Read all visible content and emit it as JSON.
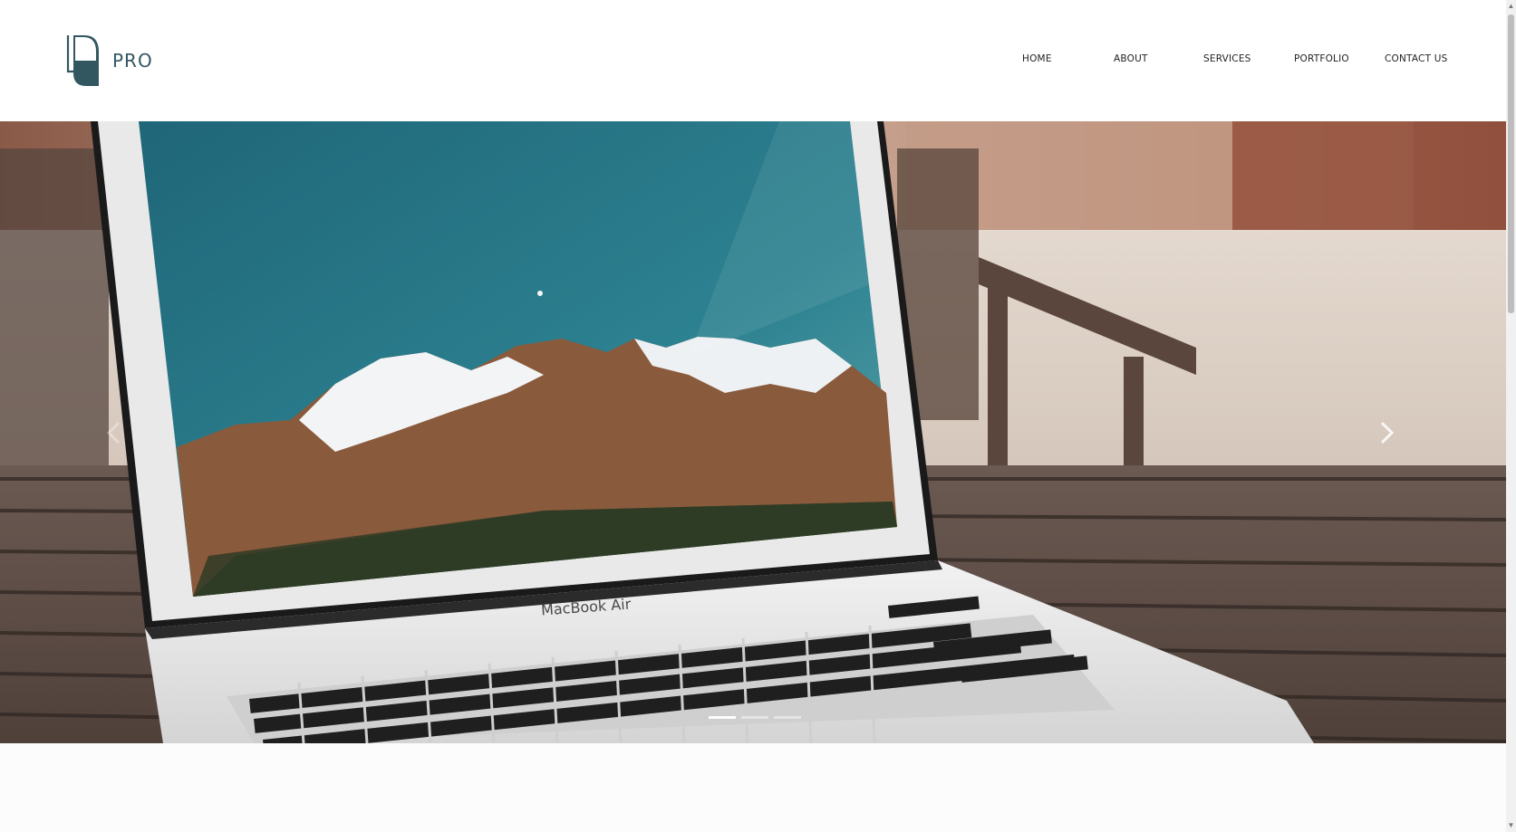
{
  "brand": {
    "name": "PRO",
    "color": "#335761"
  },
  "nav": {
    "items": [
      {
        "label": "HOME"
      },
      {
        "label": "ABOUT"
      },
      {
        "label": "SERVICES"
      },
      {
        "label": "PORTFOLIO"
      },
      {
        "label": "CONTACT US"
      }
    ]
  },
  "hero": {
    "laptop_label": "MacBook Air",
    "prev_icon": "chevron-left-icon",
    "next_icon": "chevron-right-icon",
    "slide_count": 3,
    "active_slide": 1
  }
}
